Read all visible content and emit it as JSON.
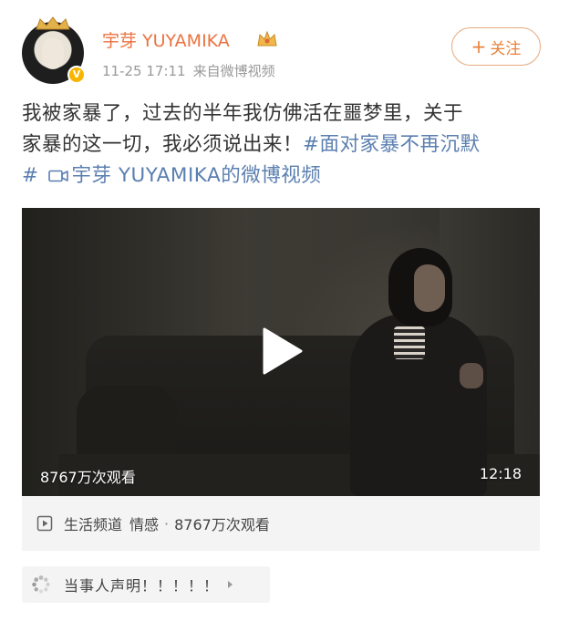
{
  "post": {
    "username": "宇芽 YUYAMIKA",
    "timestamp": "11-25 17:11",
    "source": "来自微博视频",
    "follow_label": "关注",
    "follow_plus": "+",
    "text_line1": "我被家暴了，过去的半年我仿佛活在噩梦里，关于",
    "text_line2_plain": "家暴的这一切，我必须说出来！",
    "hashtag": "#面对家暴不再沉默",
    "hashtag_end": "#",
    "video_link": "宇芽 YUYAMIKA的微博视频"
  },
  "video": {
    "views_overlay": "8767万次观看",
    "duration": "12:18"
  },
  "video_info": {
    "channel": "生活频道",
    "category": "情感",
    "separator": "·",
    "views": "8767万次观看"
  },
  "statement": {
    "text": "当事人声明！！！！！"
  },
  "icons": {
    "verified": "verified-badge-icon",
    "vip": "vip-crown-icon",
    "camera": "video-camera-icon",
    "play": "play-icon",
    "video_info": "video-play-square-icon",
    "statement": "spinner-icon",
    "arrow": "triangle-right-icon"
  },
  "colors": {
    "username": "#eb7340",
    "link": "#5b7fb0",
    "follow": "#e8823d",
    "meta": "#999999"
  }
}
